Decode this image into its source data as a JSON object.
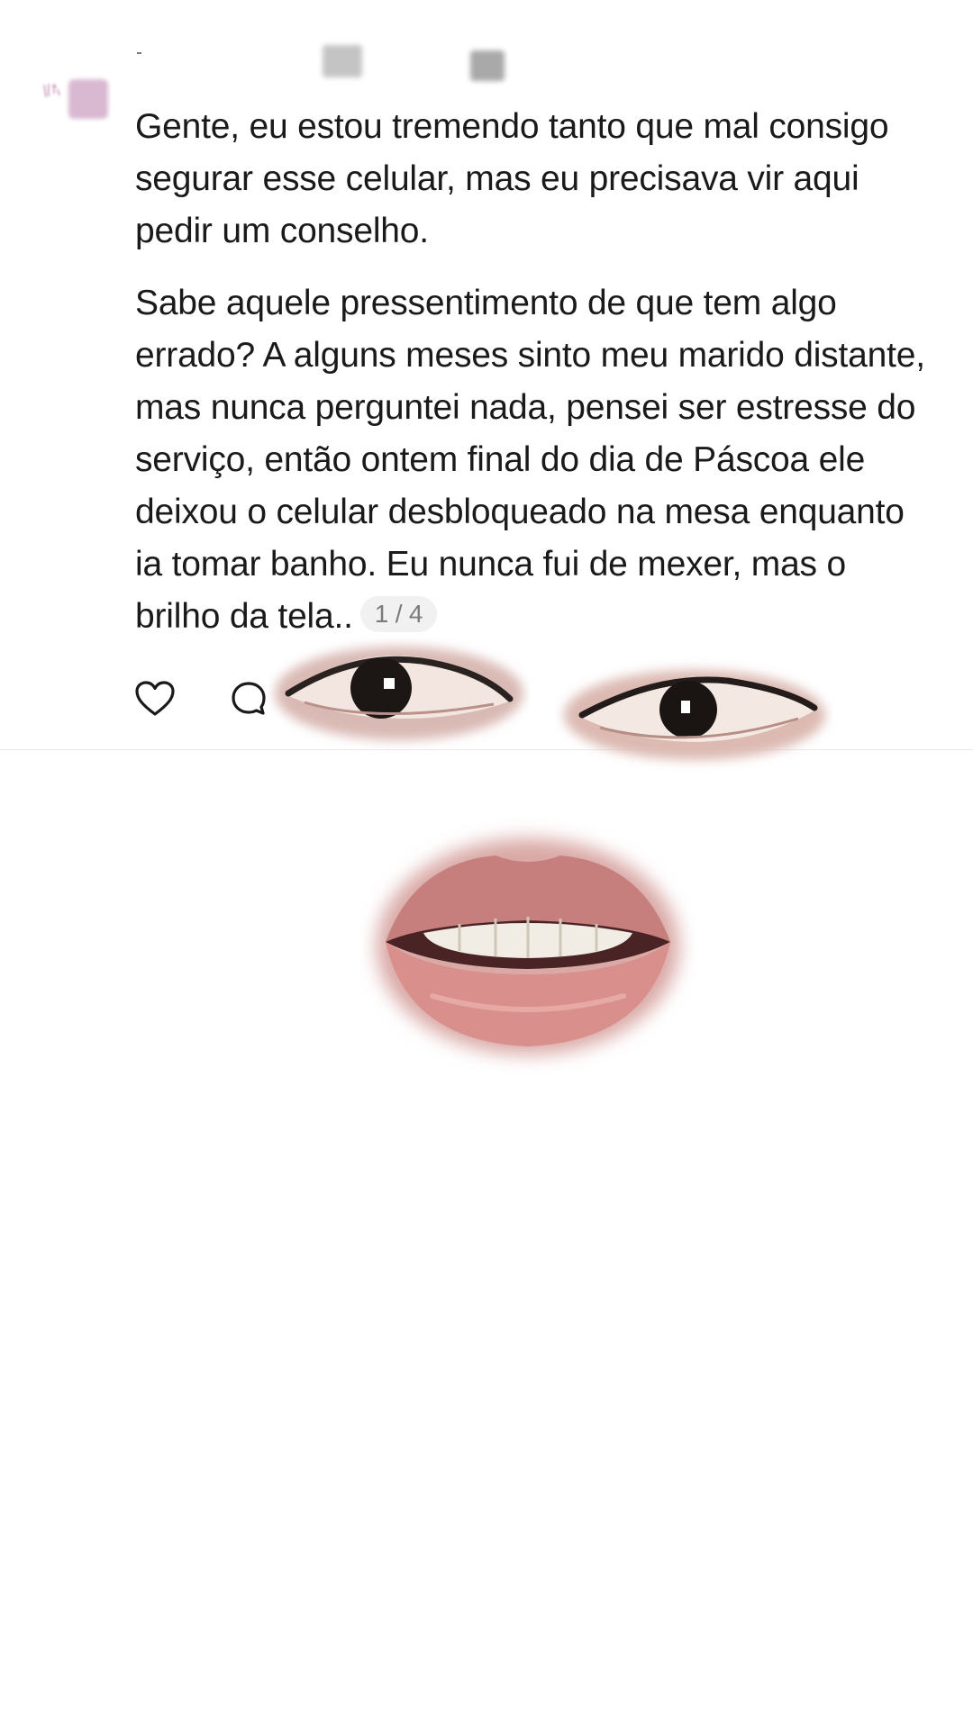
{
  "post": {
    "paragraphs": [
      "Gente, eu estou tremendo tanto que mal consigo segurar esse celular, mas eu precisava vir aqui pedir um conselho.",
      "Sabe aquele pressentimento de que tem algo errado? A alguns meses sinto  meu marido distante,  mas nunca perguntei nada, pensei ser estresse do serviço, então ontem final do dia de Páscoa ele deixou o celular desbloqueado na mesa enquanto ia tomar banho. Eu nunca fui de mexer, mas o brilho da tela.."
    ],
    "page_indicator": "1 / 4"
  },
  "actions": {
    "like_icon": "heart-outline-icon",
    "comment_icon": "comment-bubble-icon"
  },
  "colors": {
    "text": "#1a1a1a",
    "indicator_bg": "#f1f1f1",
    "indicator_text": "#7b7b7b",
    "avatar_tint": "#d9b9d1"
  }
}
